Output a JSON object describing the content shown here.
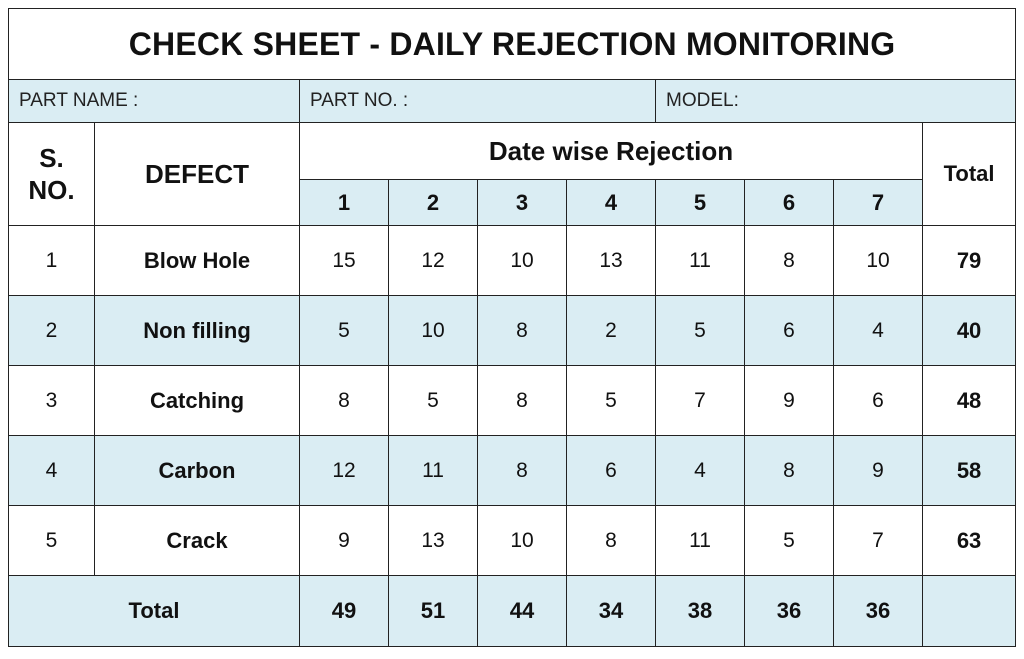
{
  "title": "CHECK SHEET - DAILY REJECTION MONITORING",
  "info": {
    "part_name_label": "PART NAME :",
    "part_no_label": "PART NO.  :",
    "model_label": "MODEL:"
  },
  "headers": {
    "sno": "S. NO.",
    "defect": "DEFECT",
    "date_wise": "Date wise Rejection",
    "total": "Total",
    "dates": [
      "1",
      "2",
      "3",
      "4",
      "5",
      "6",
      "7"
    ]
  },
  "rows": [
    {
      "sno": "1",
      "defect": "Blow Hole",
      "values": [
        "15",
        "12",
        "10",
        "13",
        "11",
        "8",
        "10"
      ],
      "total": "79"
    },
    {
      "sno": "2",
      "defect": "Non filling",
      "values": [
        "5",
        "10",
        "8",
        "2",
        "5",
        "6",
        "4"
      ],
      "total": "40"
    },
    {
      "sno": "3",
      "defect": "Catching",
      "values": [
        "8",
        "5",
        "8",
        "5",
        "7",
        "9",
        "6"
      ],
      "total": "48"
    },
    {
      "sno": "4",
      "defect": "Carbon",
      "values": [
        "12",
        "11",
        "8",
        "6",
        "4",
        "8",
        "9"
      ],
      "total": "58"
    },
    {
      "sno": "5",
      "defect": "Crack",
      "values": [
        "9",
        "13",
        "10",
        "8",
        "11",
        "5",
        "7"
      ],
      "total": "63"
    }
  ],
  "totals": {
    "label": "Total",
    "values": [
      "49",
      "51",
      "44",
      "34",
      "38",
      "36",
      "36"
    ],
    "grand": ""
  },
  "colors": {
    "shade": "#daedf3",
    "border": "#222222"
  }
}
